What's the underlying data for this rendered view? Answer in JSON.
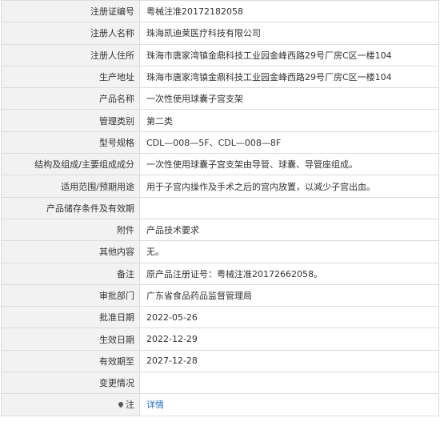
{
  "rows": [
    {
      "label": "注册证编号",
      "value": "粤械注准20172182058"
    },
    {
      "label": "注册人名称",
      "value": "珠海凯迪莱医疗科技有限公司"
    },
    {
      "label": "注册人住所",
      "value": "珠海市唐家湾镇金鼎科技工业园金峰西路29号厂房C区一楼104"
    },
    {
      "label": "生产地址",
      "value": "珠海市唐家湾镇金鼎科技工业园金峰西路29号厂房C区一楼104"
    },
    {
      "label": "产品名称",
      "value": "一次性使用球囊子宫支架"
    },
    {
      "label": "管理类别",
      "value": "第二类"
    },
    {
      "label": "型号规格",
      "value": "CDL—008—5F、CDL—008—8F"
    },
    {
      "label": "结构及组成/主要组成成分",
      "value": "一次性使用球囊子宫支架由导管、球囊、导管座组成。"
    },
    {
      "label": "适用范围/预期用途",
      "value": "用于子宫内操作及手术之后的宫内放置，以减少子宫出血。"
    },
    {
      "label": "产品储存条件及有效期",
      "value": ""
    },
    {
      "label": "附件",
      "value": "产品技术要求"
    },
    {
      "label": "其他内容",
      "value": "无。"
    },
    {
      "label": "备注",
      "value": "原产品注册证号：粤械注准20172662058。"
    },
    {
      "label": "审批部门",
      "value": "广东省食品药品监督管理局"
    },
    {
      "label": "批准日期",
      "value": "2022-05-26"
    },
    {
      "label": "生效日期",
      "value": "2022-12-29"
    },
    {
      "label": "有效期至",
      "value": "2027-12-28"
    },
    {
      "label": "变更情况",
      "value": ""
    }
  ],
  "footer": {
    "icon": "map-pin-icon",
    "label": "注",
    "link": "详情"
  },
  "colors": {
    "label_bg": "#f2f2f2",
    "border": "#dcdcdc",
    "link": "#2a6cc2"
  }
}
